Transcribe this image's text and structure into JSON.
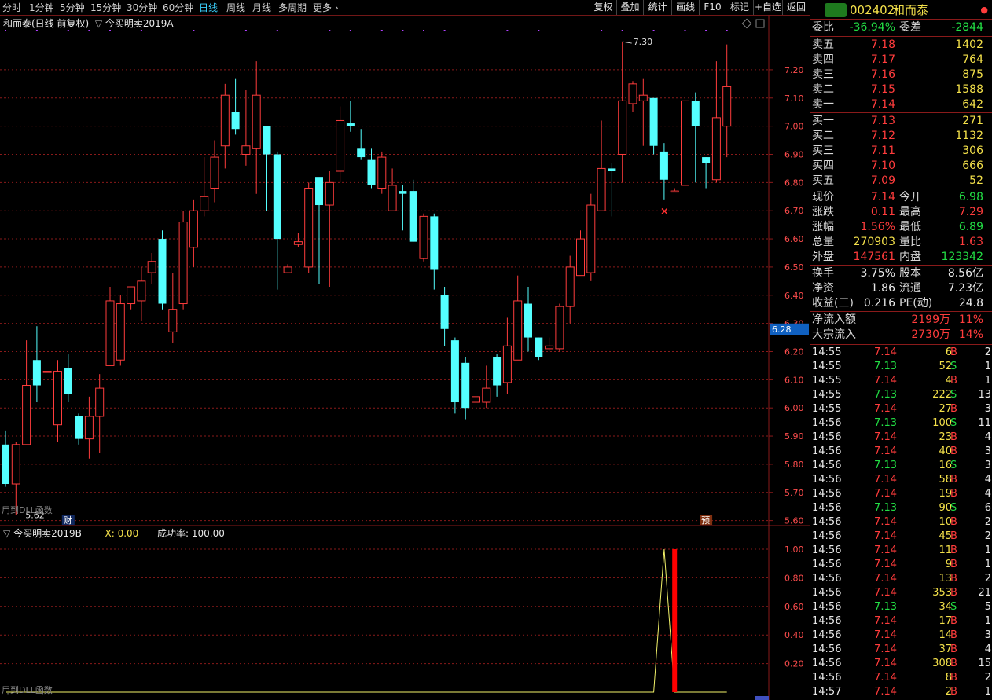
{
  "toolbar": {
    "periods": [
      "分时",
      "1分钟",
      "5分钟",
      "15分钟",
      "30分钟",
      "60分钟",
      "日线",
      "周线",
      "月线",
      "多周期",
      "更多"
    ],
    "active": "日线",
    "buttons": [
      "复权",
      "叠加",
      "统计",
      "画线",
      "F10",
      "标记",
      "+自选",
      "返回"
    ]
  },
  "chart": {
    "title": "和而泰(日线 前复权)",
    "indicator": "今买明卖2019A",
    "high_label": "7.30",
    "low_label": "5.62",
    "current_price_tag": "6.28",
    "marker_cai": "财",
    "marker_yu": "预",
    "dll_note": "用到DLL函数",
    "price_ticks": [
      "7.20",
      "7.10",
      "7.00",
      "6.90",
      "6.80",
      "6.70",
      "6.60",
      "6.50",
      "6.40",
      "6.30",
      "6.20",
      "6.10",
      "6.00",
      "5.90",
      "5.80",
      "5.70",
      "5.60"
    ]
  },
  "indicator_panel": {
    "name": "今买明卖2019B",
    "x_label": "X:",
    "x_value": "0.00",
    "rate_label": "成功率:",
    "rate_value": "100.00",
    "ticks": [
      "1.00",
      "0.80",
      "0.60",
      "0.40",
      "0.20"
    ],
    "dll_note": "用到DLL函数"
  },
  "candles": [
    [
      5.87,
      5.73,
      5.92,
      5.72
    ],
    [
      5.73,
      5.87,
      5.88,
      5.62
    ],
    [
      5.87,
      6.08,
      6.24,
      5.87
    ],
    [
      6.17,
      6.08,
      6.29,
      6.02
    ],
    [
      6.13,
      6.13,
      6.13,
      6.13
    ],
    [
      5.94,
      6.13,
      6.17,
      5.88
    ],
    [
      6.14,
      6.05,
      6.19,
      6.02
    ],
    [
      5.97,
      5.89,
      5.98,
      5.87
    ],
    [
      5.89,
      5.97,
      6.04,
      5.82
    ],
    [
      5.97,
      6.07,
      6.12,
      5.84
    ],
    [
      6.15,
      6.38,
      6.43,
      6.15
    ],
    [
      6.17,
      6.37,
      6.4,
      6.15
    ],
    [
      6.37,
      6.43,
      6.43,
      6.35
    ],
    [
      6.38,
      6.45,
      6.5,
      6.31
    ],
    [
      6.48,
      6.52,
      6.55,
      6.44
    ],
    [
      6.6,
      6.37,
      6.63,
      6.35
    ],
    [
      6.27,
      6.35,
      6.48,
      6.23
    ],
    [
      6.37,
      6.66,
      6.7,
      6.35
    ],
    [
      6.57,
      6.7,
      6.74,
      6.5
    ],
    [
      6.7,
      6.75,
      6.89,
      6.68
    ],
    [
      6.78,
      6.89,
      6.95,
      6.73
    ],
    [
      6.93,
      7.11,
      7.15,
      6.85
    ],
    [
      7.05,
      6.99,
      7.17,
      6.97
    ],
    [
      6.9,
      6.93,
      7.13,
      6.86
    ],
    [
      6.92,
      7.11,
      7.23,
      6.76
    ],
    [
      7.0,
      6.9,
      7.0,
      6.7
    ],
    [
      6.9,
      6.6,
      6.91,
      6.42
    ],
    [
      6.48,
      6.5,
      6.51,
      6.48
    ],
    [
      6.58,
      6.59,
      6.62,
      6.57
    ],
    [
      6.5,
      6.78,
      6.8,
      6.48
    ],
    [
      6.82,
      6.72,
      6.81,
      6.44
    ],
    [
      6.72,
      6.8,
      6.84,
      6.43
    ],
    [
      6.84,
      7.02,
      7.07,
      6.8
    ],
    [
      7.01,
      7.0,
      7.09,
      6.98
    ],
    [
      6.92,
      6.89,
      6.99,
      6.88
    ],
    [
      6.88,
      6.79,
      6.92,
      6.78
    ],
    [
      6.78,
      6.89,
      6.91,
      6.76
    ],
    [
      6.7,
      6.79,
      6.85,
      6.7
    ],
    [
      6.77,
      6.76,
      6.79,
      6.63
    ],
    [
      6.77,
      6.59,
      6.81,
      6.59
    ],
    [
      6.53,
      6.68,
      6.69,
      6.52
    ],
    [
      6.68,
      6.49,
      6.69,
      6.42
    ],
    [
      6.4,
      6.28,
      6.43,
      6.22
    ],
    [
      6.24,
      6.02,
      6.25,
      5.98
    ],
    [
      6.16,
      6.0,
      6.18,
      5.96
    ],
    [
      6.02,
      6.04,
      6.04,
      6.0
    ],
    [
      6.02,
      6.07,
      6.15,
      6.0
    ],
    [
      6.18,
      6.08,
      6.19,
      6.04
    ],
    [
      6.09,
      6.22,
      6.32,
      6.05
    ],
    [
      6.17,
      6.38,
      6.47,
      6.17
    ],
    [
      6.37,
      6.25,
      6.43,
      6.2
    ],
    [
      6.25,
      6.18,
      6.25,
      6.17
    ],
    [
      6.21,
      6.22,
      6.25,
      6.2
    ],
    [
      6.21,
      6.36,
      6.37,
      6.2
    ],
    [
      6.36,
      6.5,
      6.54,
      6.3
    ],
    [
      6.47,
      6.6,
      6.63,
      6.47
    ],
    [
      6.48,
      6.72,
      6.76,
      6.45
    ],
    [
      6.7,
      6.85,
      7.02,
      6.7
    ],
    [
      6.85,
      6.84,
      6.87,
      6.68
    ],
    [
      6.9,
      7.09,
      7.3,
      6.8
    ],
    [
      7.08,
      7.15,
      7.16,
      7.05
    ],
    [
      7.09,
      7.11,
      7.17,
      6.93
    ],
    [
      7.1,
      6.93,
      7.1,
      6.9
    ],
    [
      6.91,
      6.81,
      6.94,
      6.74
    ],
    [
      6.77,
      6.77,
      6.78,
      6.77
    ],
    [
      6.79,
      7.09,
      7.25,
      6.77
    ],
    [
      7.09,
      7.0,
      7.12,
      6.8
    ],
    [
      6.89,
      6.87,
      6.89,
      6.78
    ],
    [
      6.81,
      7.03,
      7.23,
      6.8
    ],
    [
      7.0,
      7.14,
      7.29,
      6.89
    ]
  ],
  "signal": [
    0,
    0,
    0,
    0,
    0,
    0,
    0,
    0,
    0,
    0,
    0,
    0,
    0,
    0,
    0,
    0,
    0,
    0,
    0,
    0,
    0,
    0,
    0,
    0,
    0,
    0,
    0,
    0,
    0,
    0,
    0,
    0,
    0,
    0,
    0,
    0,
    0,
    0,
    0,
    0,
    0,
    0,
    0,
    0,
    0,
    0,
    0,
    0,
    0,
    0,
    0,
    0,
    0,
    0,
    0,
    0,
    0,
    0,
    0,
    0,
    0,
    0,
    0,
    1,
    0,
    0,
    0,
    0,
    0,
    0
  ],
  "quote": {
    "code": "002402",
    "name": "和而泰",
    "weibi_label": "委比",
    "weibi": "-36.94%",
    "weicha_label": "委差",
    "weicha": "-2844",
    "sell": [
      {
        "label": "卖五",
        "price": "7.18",
        "vol": "1402"
      },
      {
        "label": "卖四",
        "price": "7.17",
        "vol": "764"
      },
      {
        "label": "卖三",
        "price": "7.16",
        "vol": "875"
      },
      {
        "label": "卖二",
        "price": "7.15",
        "vol": "1588"
      },
      {
        "label": "卖一",
        "price": "7.14",
        "vol": "642"
      }
    ],
    "buy": [
      {
        "label": "买一",
        "price": "7.13",
        "vol": "271"
      },
      {
        "label": "买二",
        "price": "7.12",
        "vol": "1132"
      },
      {
        "label": "买三",
        "price": "7.11",
        "vol": "306"
      },
      {
        "label": "买四",
        "price": "7.10",
        "vol": "666"
      },
      {
        "label": "买五",
        "price": "7.09",
        "vol": "52"
      }
    ],
    "stats": [
      {
        "l1": "现价",
        "v1": "7.14",
        "c1": "red",
        "l2": "今开",
        "v2": "6.98",
        "c2": "grn"
      },
      {
        "l1": "涨跌",
        "v1": "0.11",
        "c1": "red",
        "l2": "最高",
        "v2": "7.29",
        "c2": "red"
      },
      {
        "l1": "涨幅",
        "v1": "1.56%",
        "c1": "red",
        "l2": "最低",
        "v2": "6.89",
        "c2": "grn"
      },
      {
        "l1": "总量",
        "v1": "270903",
        "c1": "yel",
        "l2": "量比",
        "v2": "1.63",
        "c2": "red"
      },
      {
        "l1": "外盘",
        "v1": "147561",
        "c1": "red",
        "l2": "内盘",
        "v2": "123342",
        "c2": "grn"
      }
    ],
    "fund": [
      {
        "l1": "换手",
        "v1": "3.75%",
        "l2": "股本",
        "v2": "8.56亿"
      },
      {
        "l1": "净资",
        "v1": "1.86",
        "l2": "流通",
        "v2": "7.23亿"
      },
      {
        "l1": "收益(三)",
        "v1": "0.216",
        "l2": "PE(动)",
        "v2": "24.8"
      }
    ],
    "flow": [
      {
        "label": "净流入额",
        "amount": "2199万",
        "pct": "11%"
      },
      {
        "label": "大宗流入",
        "amount": "2730万",
        "pct": "14%"
      }
    ]
  },
  "ticks": [
    [
      "14:55",
      "7.14",
      "6",
      "B",
      "2"
    ],
    [
      "14:55",
      "7.13",
      "52",
      "S",
      "1"
    ],
    [
      "14:55",
      "7.14",
      "4",
      "B",
      "1"
    ],
    [
      "14:55",
      "7.13",
      "222",
      "S",
      "13"
    ],
    [
      "14:55",
      "7.14",
      "27",
      "B",
      "3"
    ],
    [
      "14:56",
      "7.13",
      "100",
      "S",
      "11"
    ],
    [
      "14:56",
      "7.14",
      "23",
      "B",
      "4"
    ],
    [
      "14:56",
      "7.14",
      "40",
      "B",
      "3"
    ],
    [
      "14:56",
      "7.13",
      "16",
      "S",
      "3"
    ],
    [
      "14:56",
      "7.14",
      "58",
      "B",
      "4"
    ],
    [
      "14:56",
      "7.14",
      "19",
      "B",
      "4"
    ],
    [
      "14:56",
      "7.13",
      "90",
      "S",
      "6"
    ],
    [
      "14:56",
      "7.14",
      "10",
      "B",
      "2"
    ],
    [
      "14:56",
      "7.14",
      "45",
      "B",
      "2"
    ],
    [
      "14:56",
      "7.14",
      "11",
      "B",
      "1"
    ],
    [
      "14:56",
      "7.14",
      "9",
      "B",
      "1"
    ],
    [
      "14:56",
      "7.14",
      "13",
      "B",
      "2"
    ],
    [
      "14:56",
      "7.14",
      "353",
      "B",
      "21"
    ],
    [
      "14:56",
      "7.13",
      "34",
      "S",
      "5"
    ],
    [
      "14:56",
      "7.14",
      "17",
      "B",
      "1"
    ],
    [
      "14:56",
      "7.14",
      "14",
      "B",
      "3"
    ],
    [
      "14:56",
      "7.14",
      "37",
      "B",
      "4"
    ],
    [
      "14:56",
      "7.14",
      "308",
      "B",
      "15"
    ],
    [
      "14:56",
      "7.14",
      "8",
      "B",
      "2"
    ],
    [
      "14:57",
      "7.14",
      "2",
      "B",
      "1"
    ]
  ],
  "colors": {
    "up": "#ff3c3c",
    "down": "#54ffff",
    "grid": "#8a1a1a",
    "signal_line": "#f3f36a",
    "signal_bar": "#ff0000"
  }
}
